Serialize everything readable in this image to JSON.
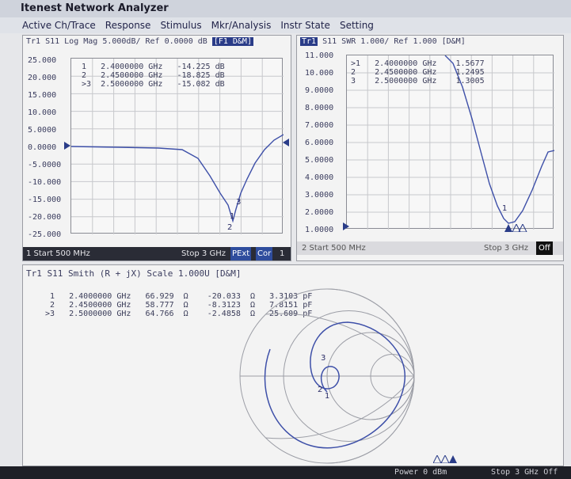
{
  "app": {
    "title": "Itenest Network Analyzer"
  },
  "menu": [
    {
      "label": "Active Ch/Trace"
    },
    {
      "label": "Response"
    },
    {
      "label": "Stimulus"
    },
    {
      "label": "Mkr/Analysis"
    },
    {
      "label": "Instr State"
    },
    {
      "label": "Setting"
    }
  ],
  "panel1": {
    "header": "Tr1 S11 Log Mag 5.000dB/ Ref  0.0000 dB",
    "header_tag": "[F1 D&M]",
    "y_labels": [
      "25.000",
      "20.000",
      "15.000",
      "10.000",
      "5.0000",
      "0.0000",
      "-5.0000",
      "-10.000",
      "-15.000",
      "-20.000",
      "-25.000"
    ],
    "markers": [
      {
        "idx": "1",
        "freq": "2.4000000 GHz",
        "val": "-14.225 dB"
      },
      {
        "idx": "2",
        "freq": "2.4500000 GHz",
        "val": "-18.825 dB"
      },
      {
        "idx": ">3",
        "freq": "2.5000000 GHz",
        "val": "-15.082 dB"
      }
    ],
    "footer": {
      "start": "1 Start 500 MHz",
      "stop": "Stop 3 GHz",
      "pext": "PExt",
      "cor": "Cor",
      "num": "1"
    }
  },
  "panel2": {
    "header_tag": "Tr1",
    "header": "S11 SWR 1.000/ Ref  1.000  [D&M]",
    "y_labels": [
      "11.000",
      "10.000",
      "9.0000",
      "8.0000",
      "7.0000",
      "6.0000",
      "5.0000",
      "4.0000",
      "3.0000",
      "2.0000",
      "1.0000"
    ],
    "markers": [
      {
        "idx": ">1",
        "freq": "2.4000000 GHz",
        "val": "1.5677"
      },
      {
        "idx": "2",
        "freq": "2.4500000 GHz",
        "val": "1.2495"
      },
      {
        "idx": "3",
        "freq": "2.5000000 GHz",
        "val": "1.3005"
      }
    ],
    "footer": {
      "start": "2 Start 500 MHz",
      "stop": "Stop 3 GHz",
      "off": "Off"
    }
  },
  "panel3": {
    "header": "Tr1 S11 Smith (R + jX) Scale 1.000U [D&M]",
    "markers": [
      {
        "idx": "1",
        "freq": "2.4000000 GHz",
        "r": "66.929",
        "ru": "Ω",
        "x": "-20.033",
        "xu": "Ω",
        "c": "3.3103 pF"
      },
      {
        "idx": "2",
        "freq": "2.4500000 GHz",
        "r": "58.777",
        "ru": "Ω",
        "x": "-8.3123",
        "xu": "Ω",
        "c": "7.8151 pF"
      },
      {
        "idx": ">3",
        "freq": "2.5000000 GHz",
        "r": "64.766",
        "ru": "Ω",
        "x": "-2.4858",
        "xu": "Ω",
        "c": "25.609 pF"
      }
    ]
  },
  "bottombar": {
    "power": "Power 0 dBm",
    "stop": "Stop 3 GHz Off"
  },
  "colors": {
    "trace": "#3d4fa8",
    "panel_bg": "#f3f3f3",
    "footer_bg": "#2a2c36",
    "accent": "#2f4d9d"
  }
}
